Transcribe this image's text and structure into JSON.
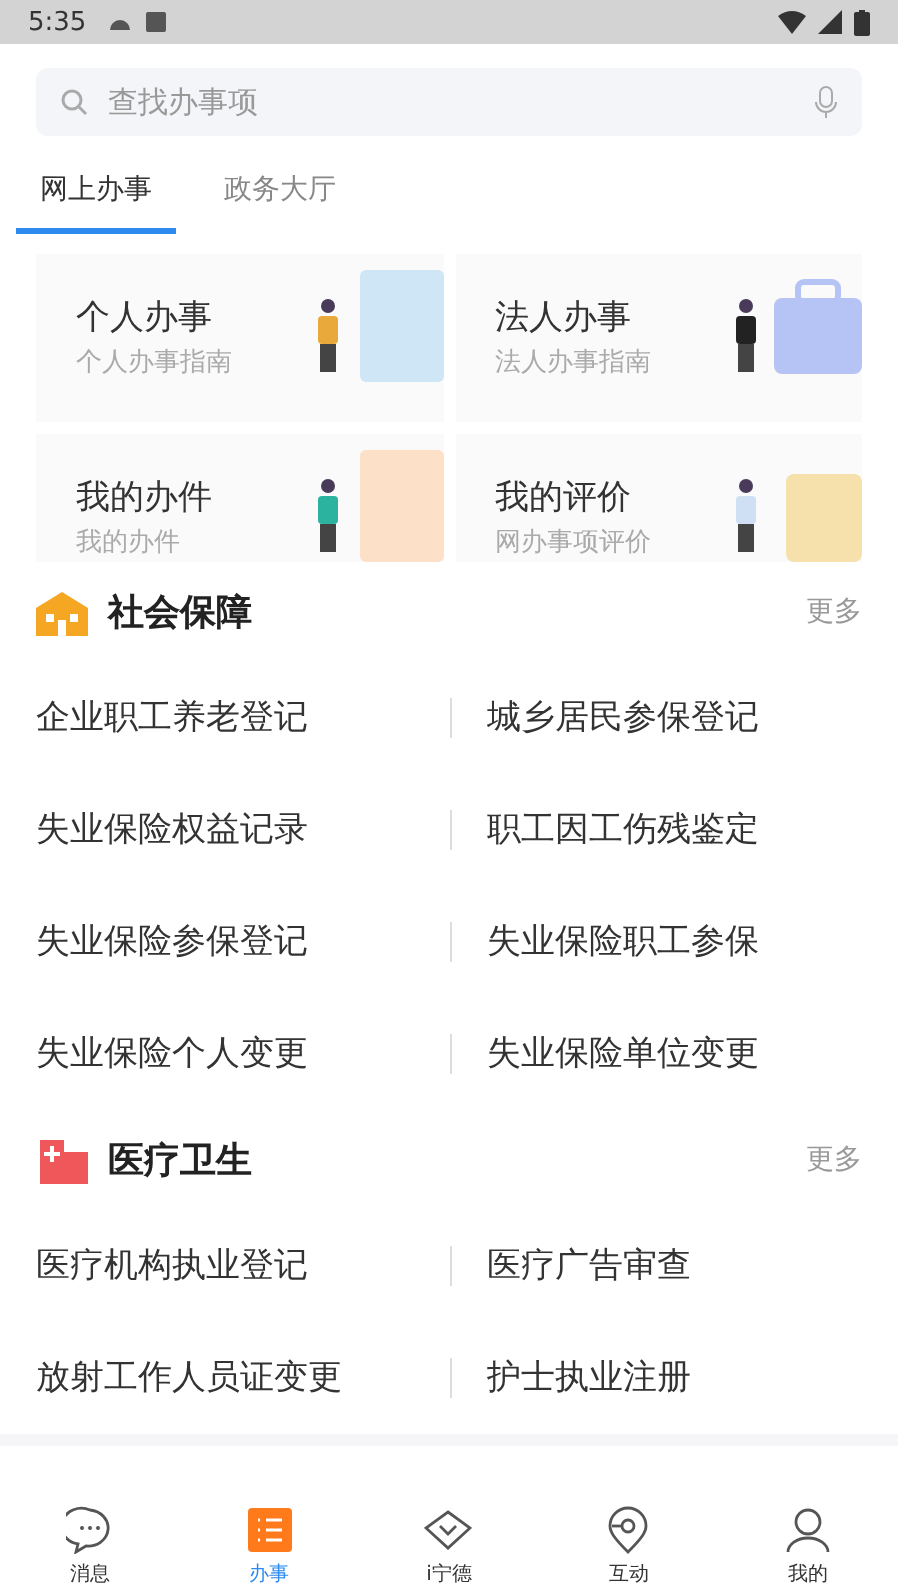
{
  "status_bar": {
    "time": "5:35"
  },
  "search": {
    "placeholder": "查找办事项"
  },
  "tabs": [
    {
      "label": "网上办事",
      "selected": true
    },
    {
      "label": "政务大厅",
      "selected": false
    }
  ],
  "cards": [
    {
      "title": "个人办事",
      "subtitle": "个人办事指南",
      "kind": "person"
    },
    {
      "title": "法人办事",
      "subtitle": "法人办事指南",
      "kind": "briefcase"
    },
    {
      "title": "我的办件",
      "subtitle": "我的办件",
      "kind": "files"
    },
    {
      "title": "我的评价",
      "subtitle": "网办事项评价",
      "kind": "rating"
    }
  ],
  "sections": [
    {
      "title": "社会保障",
      "more": "更多",
      "kind": "building",
      "items": [
        "企业职工养老登记",
        "城乡居民参保登记",
        "失业保险权益记录",
        "职工因工伤残鉴定",
        "失业保险参保登记",
        "失业保险职工参保",
        "失业保险个人变更",
        "失业保险单位变更"
      ]
    },
    {
      "title": "医疗卫生",
      "more": "更多",
      "kind": "hospital",
      "items": [
        "医疗机构执业登记",
        "医疗广告审查",
        "放射工作人员证变更",
        "护士执业注册"
      ]
    }
  ],
  "nav": [
    {
      "label": "消息",
      "kind": "chat",
      "selected": false
    },
    {
      "label": "办事",
      "kind": "list",
      "selected": true
    },
    {
      "label": "i宁德",
      "kind": "diamond",
      "selected": false
    },
    {
      "label": "互动",
      "kind": "pin",
      "selected": false
    },
    {
      "label": "我的",
      "kind": "user",
      "selected": false
    }
  ]
}
